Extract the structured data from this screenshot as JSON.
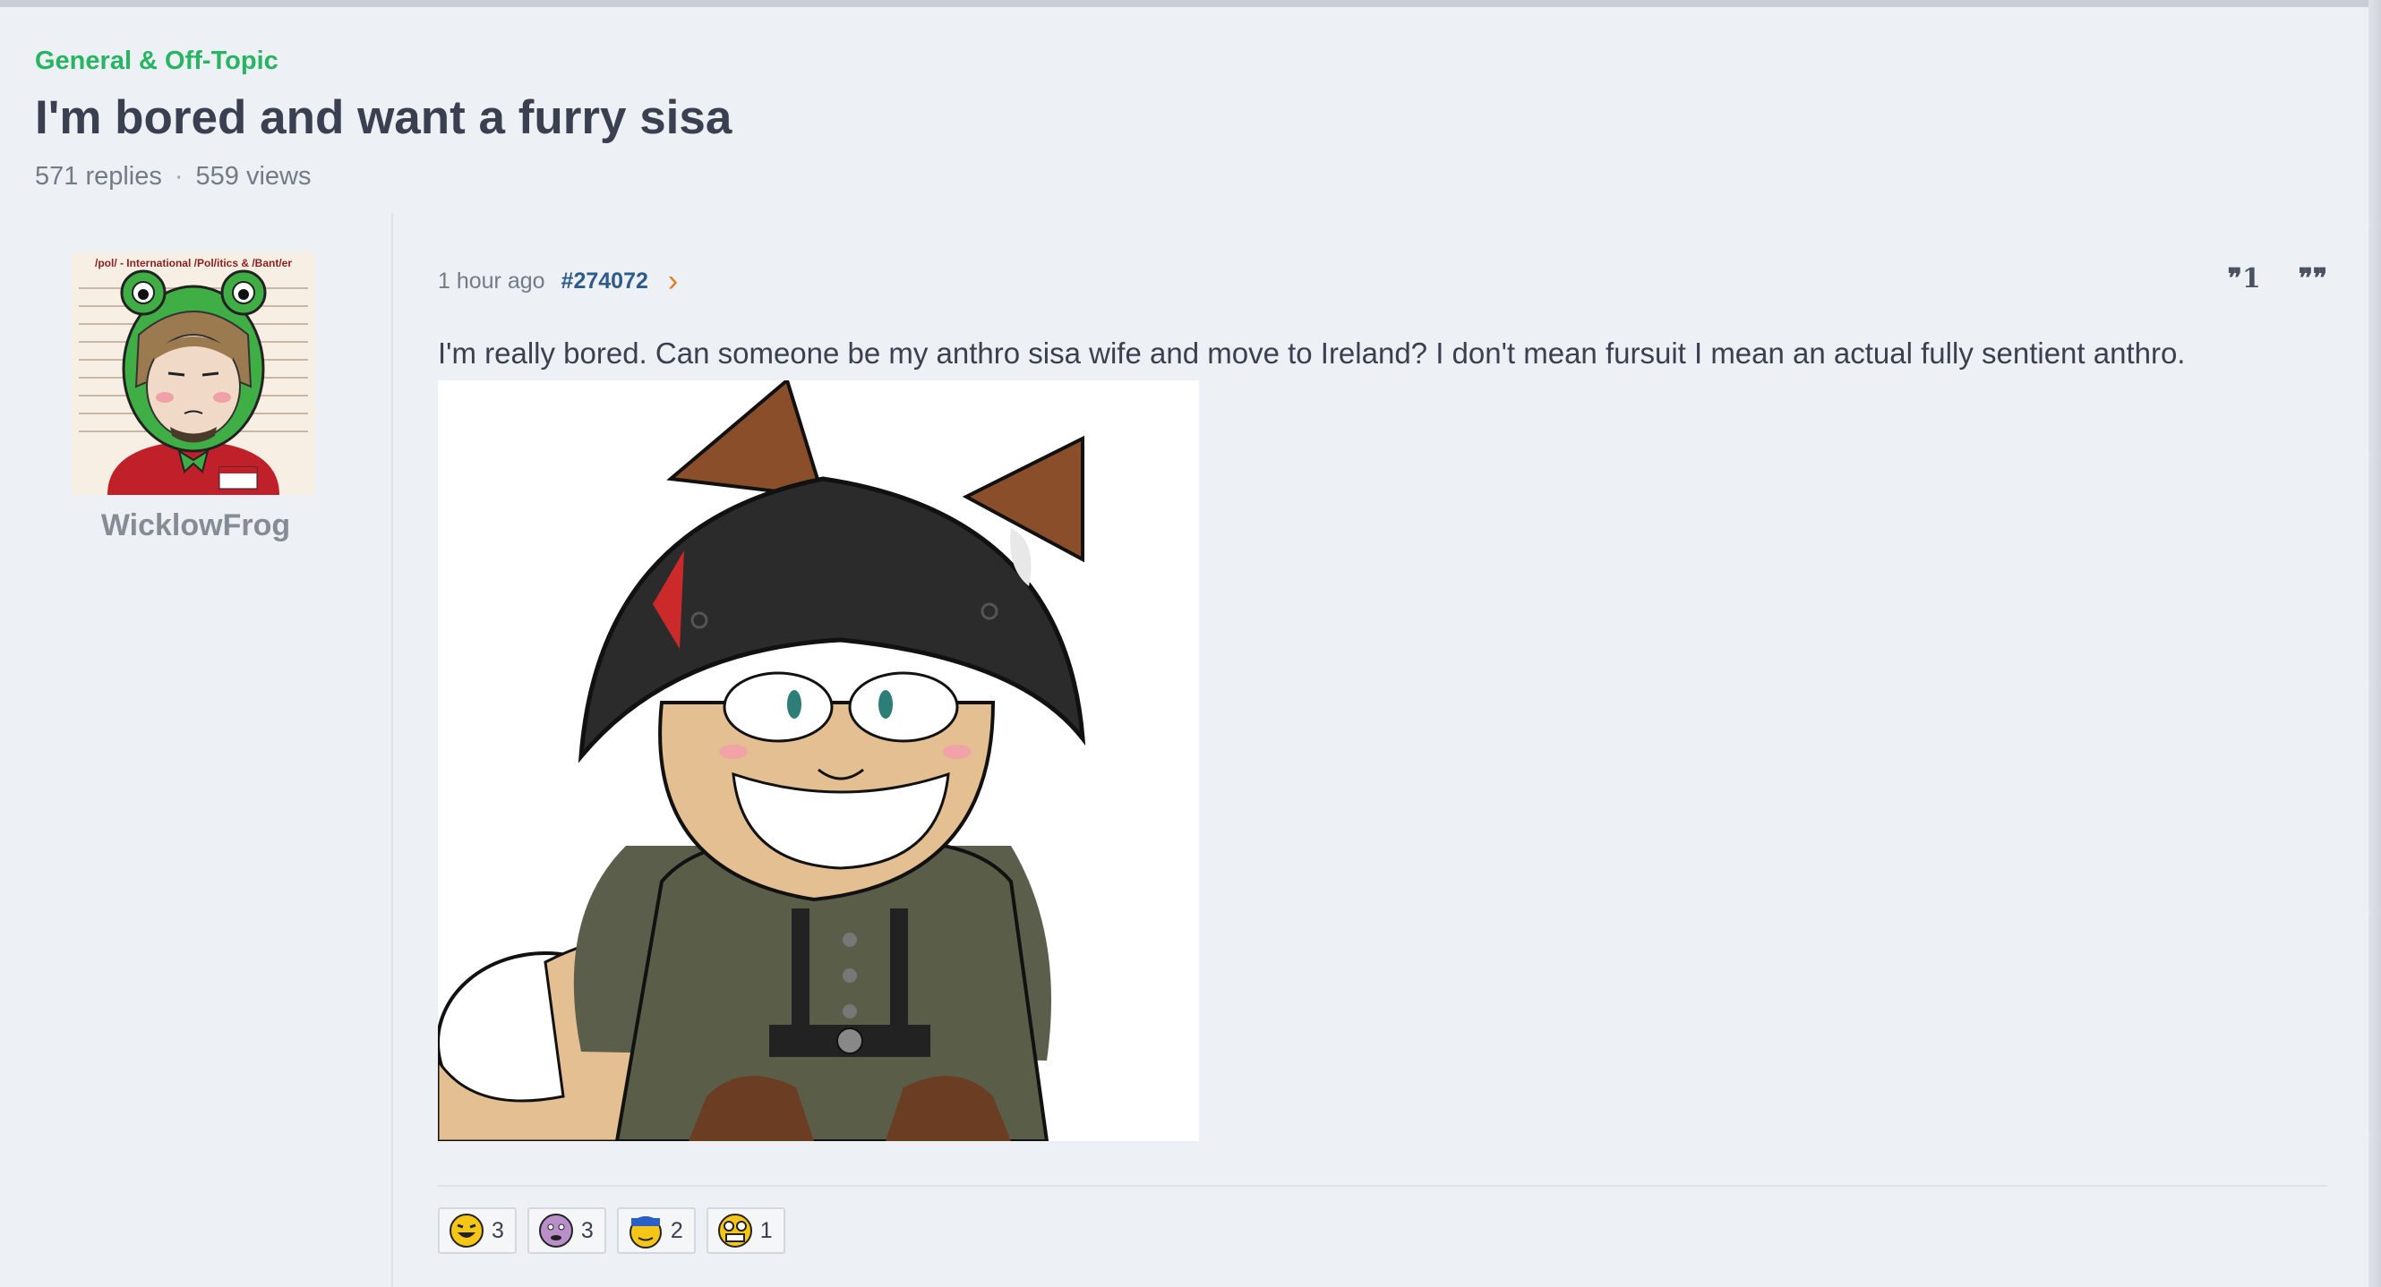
{
  "thread": {
    "category": "General & Off-Topic",
    "title": "I'm bored and want a furry sisa",
    "replies": "571 replies",
    "separator": "·",
    "views": "559 views"
  },
  "user": {
    "name": "WicklowFrog",
    "avatar_caption": "/pol/ - International /Pol/itics & /Bant/er"
  },
  "post": {
    "time": "1 hour ago",
    "id": "#274072",
    "quote_one_label": "99 1",
    "quote_label": "99",
    "body": "I'm really bored. Can someone be my anthro sisa wife and move to Ireland? I don't mean fursuit I mean an actual fully sentient anthro."
  },
  "reactions": [
    {
      "icon": "laughing-face-icon",
      "count": "3"
    },
    {
      "icon": "purple-sad-face-icon",
      "count": "3"
    },
    {
      "icon": "cap-face-icon",
      "count": "2"
    },
    {
      "icon": "grinning-face-icon",
      "count": "1"
    }
  ],
  "colors": {
    "category": "#27b562",
    "post_id": "#2e5a8a",
    "arrow": "#e07b20",
    "background": "#edf1f5"
  }
}
